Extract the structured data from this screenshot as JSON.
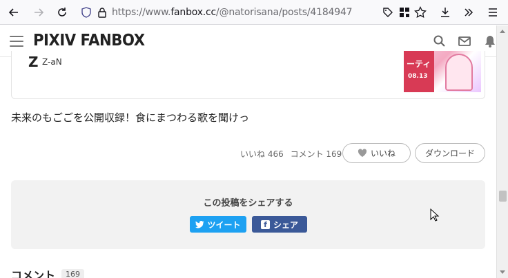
{
  "browser": {
    "url_prefix": "https://www.",
    "url_host": "fanbox.cc",
    "url_path": "/@natorisana/posts/4184947"
  },
  "header": {
    "logo": "PIXIV FANBOX"
  },
  "creator_card": {
    "initial": "Z",
    "name": "Z-aN",
    "thumbnail_text": "ーティ",
    "thumbnail_date": "08.13"
  },
  "post": {
    "title": "未来のもごごを公開収録！食にまつわる歌を聞けっ"
  },
  "actions": {
    "likes_label": "いいね 466",
    "comments_label": "コメント 169",
    "like_button": "いいね",
    "download_button": "ダウンロード"
  },
  "share": {
    "title": "この投稿をシェアする",
    "tweet_button": "ツイート",
    "facebook_button": "シェア"
  },
  "comments": {
    "heading": "コメント",
    "count": "169"
  },
  "colors": {
    "twitter": "#1da1f2",
    "facebook": "#3b5998"
  }
}
